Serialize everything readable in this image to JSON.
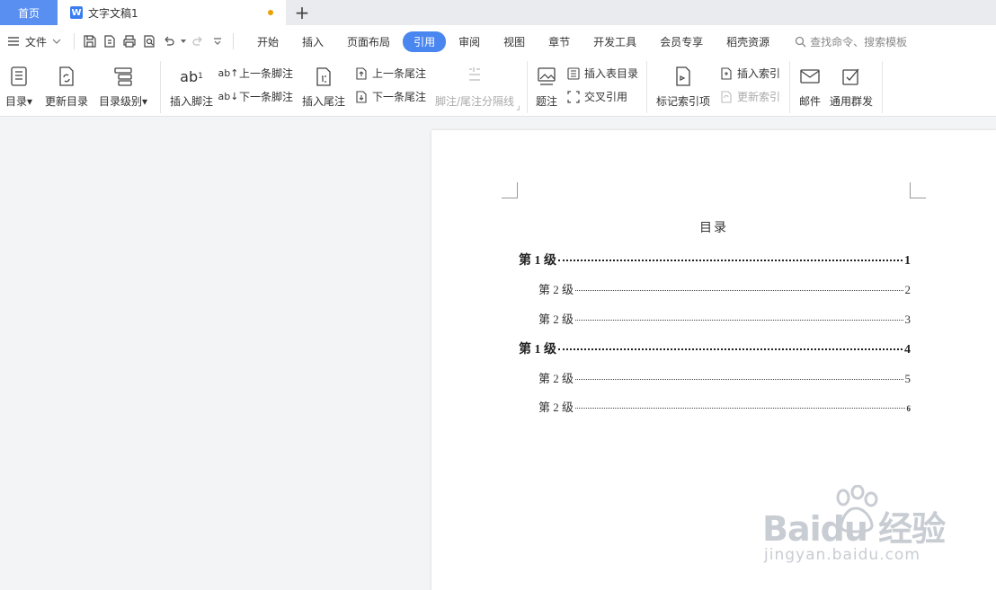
{
  "tabs": {
    "home_label": "首页",
    "doc_label": "文字文稿1",
    "doc_icon": "W",
    "add_label": "+"
  },
  "menu": {
    "file_label": "文件",
    "tabs": [
      "开始",
      "插入",
      "页面布局",
      "引用",
      "审阅",
      "视图",
      "章节",
      "开发工具",
      "会员专享",
      "稻壳资源"
    ],
    "active_tab": "引用",
    "search_label": "查找命令、搜索模板"
  },
  "ribbon": {
    "toc": "目录",
    "update_toc": "更新目录",
    "toc_level": "目录级别",
    "insert_footnote": "插入脚注",
    "footnote_icon_text": "ab",
    "prev_footnote": "上一条脚注",
    "next_footnote": "下一条脚注",
    "insert_endnote": "插入尾注",
    "prev_endnote": "上一条尾注",
    "next_endnote": "下一条尾注",
    "separator_line": "脚注/尾注分隔线",
    "caption": "题注",
    "insert_table_of_figures": "插入表目录",
    "cross_reference": "交叉引用",
    "mark_index_entry": "标记索引项",
    "insert_index": "插入索引",
    "update_index": "更新索引",
    "mail": "邮件",
    "mail_merge": "通用群发"
  },
  "document": {
    "toc_title": "目录",
    "entries": [
      {
        "label": "第 1 级",
        "page": "1",
        "level": 1
      },
      {
        "label": "第 2 级",
        "page": "2",
        "level": 2
      },
      {
        "label": "第 2 级",
        "page": "3",
        "level": 2
      },
      {
        "label": "第 1 级",
        "page": "4",
        "level": 1
      },
      {
        "label": "第 2 级",
        "page": "5",
        "level": 2
      },
      {
        "label": "第 2 级",
        "page": "6",
        "level": 2
      }
    ]
  },
  "watermark": {
    "main": "Baidu 经验",
    "sub": "jingyan.baidu.com"
  },
  "colors": {
    "accent": "#4a86f0",
    "home_tab": "#5a8ff2",
    "unsaved_dot": "#e8a100"
  }
}
